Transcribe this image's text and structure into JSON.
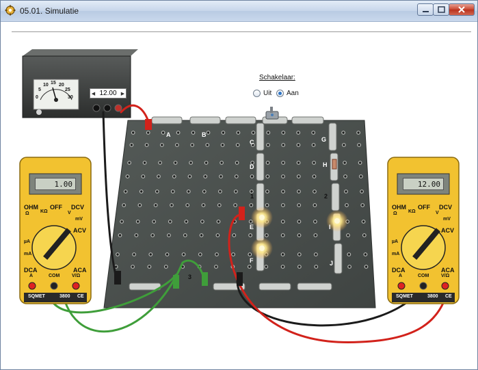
{
  "window": {
    "title": "05.01. Simulatie",
    "controls": {
      "minimize": "minimize",
      "maximize": "maximize",
      "close": "close"
    }
  },
  "switch_panel": {
    "title": "Schakelaar:",
    "options": [
      {
        "label": "Uit",
        "selected": false
      },
      {
        "label": "Aan",
        "selected": true
      }
    ]
  },
  "power_supply": {
    "voltage_setting": "12.00",
    "dial_labels": [
      "0",
      "5",
      "10",
      "15",
      "20",
      "25",
      "30"
    ]
  },
  "multimeter_left": {
    "reading": "1.00",
    "mode_labels": {
      "ohm": "OHM",
      "off": "OFF",
      "dcv": "DCV",
      "acv": "ACV",
      "dca": "DCA",
      "aca": "ACA",
      "v": "V",
      "mv": "mV",
      "kohm": "KΩ",
      "ohm_sym": "Ω",
      "ua": "µA",
      "ma": "mA",
      "a": "A"
    },
    "ports": [
      "A",
      "COM",
      "V/Ω"
    ],
    "brand": "SQMET",
    "model": "3800",
    "mark": "CE"
  },
  "multimeter_right": {
    "reading": "12.00",
    "mode_labels": {
      "ohm": "OHM",
      "off": "OFF",
      "dcv": "DCV",
      "acv": "ACV",
      "dca": "DCA",
      "aca": "ACA",
      "v": "V",
      "mv": "mV",
      "kohm": "KΩ",
      "ohm_sym": "Ω",
      "ua": "µA",
      "ma": "mA",
      "a": "A"
    },
    "ports": [
      "A",
      "COM",
      "V/Ω"
    ],
    "brand": "SQMET",
    "model": "3800",
    "mark": "CE"
  },
  "board": {
    "component_labels": [
      "A",
      "B",
      "C",
      "D",
      "E",
      "F",
      "G",
      "H",
      "I",
      "J"
    ],
    "node_labels": [
      "1",
      "2",
      "3"
    ]
  },
  "colors": {
    "multimeter_body": "#f2c230",
    "board": "#4a4f4d",
    "wire_red": "#d2221b",
    "wire_black": "#1b1b1b",
    "wire_green": "#3f9e3a",
    "lamp_glow": "#fff3b5"
  }
}
